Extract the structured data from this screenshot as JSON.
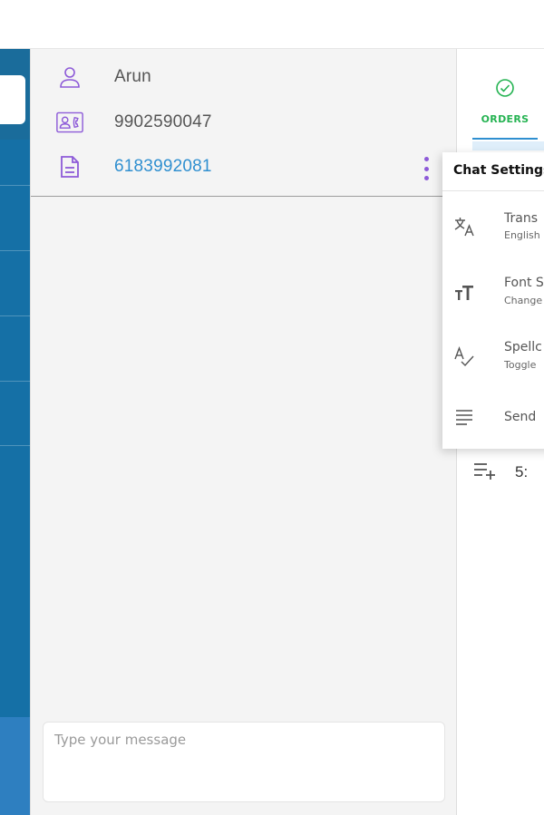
{
  "contact": {
    "name": "Arun",
    "phone": "9902590047",
    "order_id": "6183992081"
  },
  "composer": {
    "placeholder": "Type your message"
  },
  "right_panel": {
    "tab_orders_label": "ORDERS",
    "list_item_number": "5:"
  },
  "chat_settings": {
    "title": "Chat Settings",
    "items": [
      {
        "title": "Trans",
        "subtitle": "English",
        "icon": "translate-icon"
      },
      {
        "title": "Font S",
        "subtitle": "Change",
        "icon": "font-size-icon"
      },
      {
        "title": "Spellc",
        "subtitle": "Toggle",
        "icon": "spellcheck-icon"
      },
      {
        "title": "Send",
        "subtitle": "",
        "icon": "send-text-icon"
      }
    ]
  },
  "colors": {
    "sidebar_blue": "#1570a6",
    "accent_purple": "#8d5ad8",
    "link_blue": "#2f8fd0",
    "orders_green": "#25b352"
  }
}
